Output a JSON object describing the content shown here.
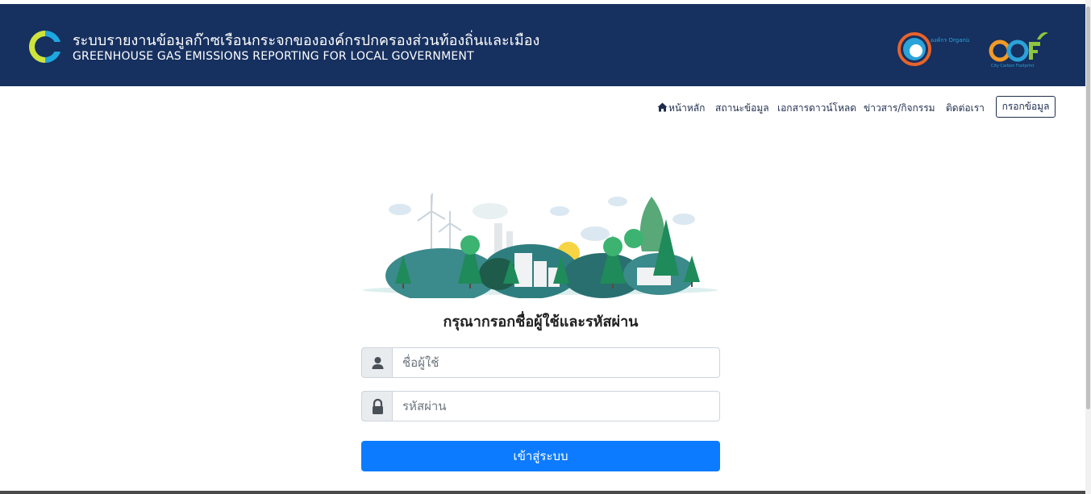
{
  "header": {
    "title_th": "ระบบรายงานข้อมูลก๊าซเรือนกระจกขององค์กรปกครองส่วนท้องถิ่นและเมือง",
    "title_en": "GREENHOUSE GAS EMISSIONS REPORTING FOR LOCAL GOVERNMENT",
    "org_logo_text": "องค์กร Organization",
    "ccf_logo_text": "City Carbon Footprint"
  },
  "nav": {
    "items": [
      {
        "label": "หน้าหลัก",
        "icon": "home-icon"
      },
      {
        "label": "สถานะข้อมูล"
      },
      {
        "label": "เอกสารดาวน์โหลด"
      },
      {
        "label": "ข่าวสาร/กิจกรรม"
      },
      {
        "label": "ติดต่อเรา"
      }
    ],
    "button_label": "กรอกข้อมูล"
  },
  "login": {
    "prompt": "กรุณากรอกชื่อผู้ใช้และรหัสผ่าน",
    "username_placeholder": "ชื่อผู้ใช้",
    "password_placeholder": "รหัสผ่าน",
    "username_icon": "user-icon",
    "password_icon": "lock-icon",
    "submit_label": "เข้าสู่ระบบ"
  },
  "colors": {
    "header_bg": "#16305f",
    "primary_button": "#0d7bff",
    "nav_text": "#1f2d4e"
  }
}
